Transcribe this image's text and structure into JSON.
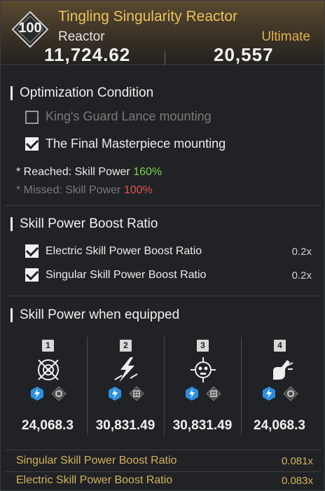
{
  "header": {
    "level": "100",
    "title": "Tingling Singularity Reactor",
    "type": "Reactor",
    "grade": "Ultimate",
    "stat_left": "11,724.62",
    "stat_right": "20,557"
  },
  "optimization": {
    "title": "Optimization Condition",
    "conditions": [
      {
        "label": "King's Guard Lance mounting",
        "checked": false
      },
      {
        "label": "The Final Masterpiece mounting",
        "checked": true
      }
    ],
    "reached_prefix": "* Reached: Skill Power ",
    "reached_value": "160%",
    "missed_prefix": "* Missed: Skill Power ",
    "missed_value": "100%"
  },
  "boost": {
    "title": "Skill Power Boost Ratio",
    "items": [
      {
        "label": "Electric Skill Power Boost Ratio",
        "value": "0.2x",
        "checked": true
      },
      {
        "label": "Singular Skill Power Boost Ratio",
        "value": "0.2x",
        "checked": true
      }
    ]
  },
  "equipped": {
    "title": "Skill Power when equipped",
    "columns": [
      {
        "num": "1",
        "icon": "target-skill-icon",
        "value": "24,068.3"
      },
      {
        "num": "2",
        "icon": "lightning-strike-skill-icon",
        "value": "30,831.49"
      },
      {
        "num": "3",
        "icon": "skull-burst-skill-icon",
        "value": "30,831.49"
      },
      {
        "num": "4",
        "icon": "hand-blast-skill-icon",
        "value": "24,068.3"
      }
    ],
    "element_icons": [
      "electric-element-icon",
      "singular-element-icon"
    ]
  },
  "bottom": [
    {
      "label": "Singular Skill Power Boost Ratio",
      "value": "0.081x"
    },
    {
      "label": "Electric Skill Power Boost Ratio",
      "value": "0.083x"
    }
  ],
  "colors": {
    "title_gold": "#ecc25e",
    "ultimate_gold": "#e2b34a",
    "green": "#7bd24a",
    "red": "#e05454",
    "electric_blue": "#2b8fe0"
  }
}
